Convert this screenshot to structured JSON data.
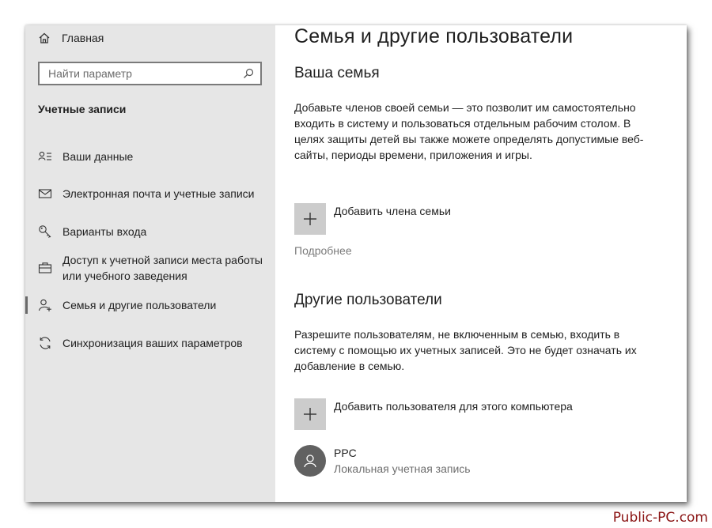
{
  "sidebar": {
    "home_label": "Главная",
    "search_placeholder": "Найти параметр",
    "section_title": "Учетные записи",
    "items": [
      {
        "label": "Ваши данные",
        "icon": "person-card-icon"
      },
      {
        "label": "Электронная почта и учетные записи",
        "icon": "mail-icon"
      },
      {
        "label": "Варианты входа",
        "icon": "key-icon"
      },
      {
        "label": "Доступ к учетной записи места работы или учебного заведения",
        "icon": "briefcase-icon"
      },
      {
        "label": "Семья и другие пользователи",
        "icon": "person-add-icon",
        "active": true
      },
      {
        "label": "Синхронизация ваших параметров",
        "icon": "sync-icon"
      }
    ]
  },
  "main": {
    "title": "Семья и другие пользователи",
    "family": {
      "heading": "Ваша семья",
      "description": "Добавьте членов своей семьи — это позволит им самостоятельно входить в систему и пользоваться отдельным рабочим столом. В целях защиты детей вы также можете определять допустимые веб-сайты, периоды времени, приложения и игры.",
      "add_label": "Добавить члена семьи",
      "more_link": "Подробнее"
    },
    "others": {
      "heading": "Другие пользователи",
      "description": "Разрешите пользователям, не включенным в семью, входить в систему с помощью их учетных записей. Это не будет означать их добавление в семью.",
      "add_label": "Добавить пользователя для этого компьютера",
      "user": {
        "name": "PPC",
        "type": "Локальная учетная запись"
      }
    }
  },
  "watermark": "Public-PC.com",
  "colors": {
    "sidebar_bg": "#e6e6e6",
    "tile_bg": "#cccccc",
    "avatar_bg": "#616161",
    "watermark": "#8a1414"
  }
}
